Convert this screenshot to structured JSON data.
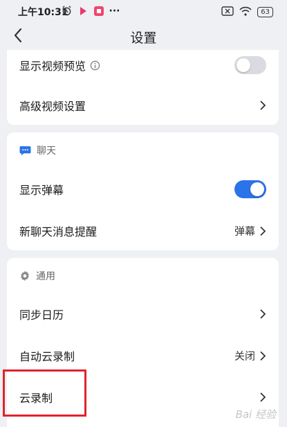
{
  "status": {
    "time": "上午10:31",
    "battery": "63",
    "more": "···"
  },
  "header": {
    "title": "设置"
  },
  "video": {
    "preview_label": "显示视频预览",
    "preview_on": false,
    "advanced_label": "高级视频设置"
  },
  "chat": {
    "section": "聊天",
    "danmu_label": "显示弹幕",
    "danmu_on": true,
    "remind_label": "新聊天消息提醒",
    "remind_value": "弹幕"
  },
  "general": {
    "section": "通用",
    "calendar_label": "同步日历",
    "auto_record_label": "自动云录制",
    "auto_record_value": "关闭",
    "cloud_record_label": "云录制"
  },
  "watermark": "Bai 经验",
  "colors": {
    "accent": "#2b73e8",
    "highlight": "#e0232b"
  }
}
